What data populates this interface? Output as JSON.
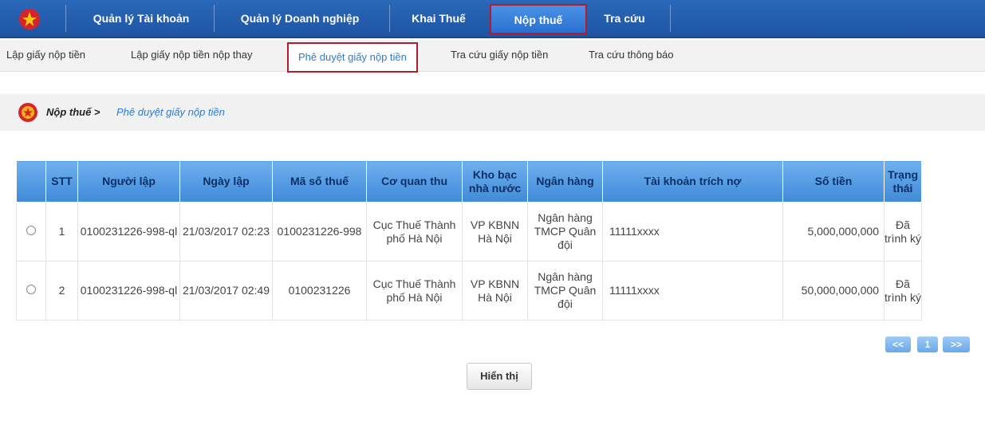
{
  "topnav": {
    "items": [
      "Quản lý Tài khoản",
      "Quản lý Doanh nghiệp",
      "Khai Thuế",
      "Nộp thuế",
      "Tra cứu"
    ],
    "active": "Nộp thuế"
  },
  "subnav": {
    "items": [
      "Lập giấy nộp tiền",
      "Lập giấy nộp tiền nộp thay",
      "Phê duyệt giấy nộp tiền",
      "Tra cứu giấy nộp tiền",
      "Tra cứu thông báo"
    ],
    "active": "Phê duyệt giấy nộp tiền"
  },
  "breadcrumb": {
    "root": "Nộp thuế >",
    "current": "Phê duyệt giấy nộp tiền"
  },
  "table": {
    "headers": [
      "STT",
      "Người lập",
      "Ngày lập",
      "Mã số thuế",
      "Cơ quan thu",
      "Kho bạc nhà nước",
      "Ngân hàng",
      "Tài khoản trích nợ",
      "Số tiền",
      "Trạng thái"
    ],
    "rows": [
      {
        "stt": "1",
        "nguoi_lap": "0100231226-998-ql",
        "ngay_lap": "21/03/2017 02:23",
        "mst": "0100231226-998",
        "co_quan_thu": "Cục Thuế Thành phố Hà Nội",
        "kho_bac": "VP KBNN Hà Nội",
        "ngan_hang": "Ngân hàng TMCP Quân đội",
        "tai_khoan": "11111xxxx",
        "so_tien": "5,000,000,000",
        "trang_thai": "Đã trình ký"
      },
      {
        "stt": "2",
        "nguoi_lap": "0100231226-998-ql",
        "ngay_lap": "21/03/2017 02:49",
        "mst": "0100231226",
        "co_quan_thu": "Cục Thuế Thành phố Hà Nội",
        "kho_bac": "VP KBNN Hà Nội",
        "ngan_hang": "Ngân hàng TMCP Quân đội",
        "tai_khoan": "11111xxxx",
        "so_tien": "50,000,000,000",
        "trang_thai": "Đã trình ký"
      }
    ]
  },
  "pager": {
    "prev": "<<",
    "page": "1",
    "next": ">>"
  },
  "buttons": {
    "show": "Hiển thị"
  },
  "colors": {
    "nav_bg": "#1e55a3",
    "highlight": "#b31c2a",
    "link": "#2b7bd1",
    "header_bg": "#3f8ad8"
  }
}
